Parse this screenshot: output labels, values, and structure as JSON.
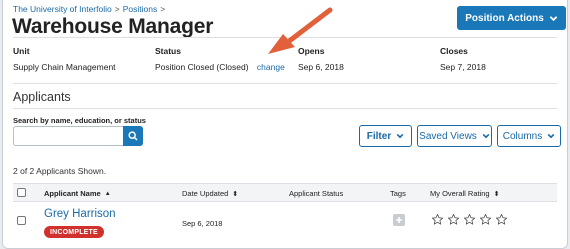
{
  "breadcrumb": {
    "root": "The University of Interfolio",
    "sep": ">",
    "current": "Positions",
    "trail": ">"
  },
  "header": {
    "title": "Warehouse Manager",
    "actions_label": "Position Actions"
  },
  "meta": {
    "unit_label": "Unit",
    "unit_value": "Supply Chain Management",
    "status_label": "Status",
    "status_value": "Position Closed (Closed)",
    "status_change": "change",
    "opens_label": "Opens",
    "opens_value": "Sep 6, 2018",
    "closes_label": "Closes",
    "closes_value": "Sep 7, 2018"
  },
  "applicants": {
    "heading": "Applicants",
    "search_label": "Search by name, education, or status",
    "search_value": "",
    "filter_label": "Filter",
    "saved_views_label": "Saved Views",
    "columns_label": "Columns",
    "count_text": "2 of 2 Applicants Shown.",
    "columns": {
      "name": "Applicant Name",
      "name_sort": "▲",
      "date": "Date Updated",
      "date_sort": "⬍",
      "status": "Applicant Status",
      "tags": "Tags",
      "rating": "My Overall Rating",
      "rating_sort": "⬍"
    },
    "rows": [
      {
        "name": "Grey Harrison",
        "badge": "INCOMPLETE",
        "date": "Sep 6, 2018",
        "status": "",
        "rating": 0,
        "rating_max": 5
      }
    ]
  },
  "colors": {
    "primary": "#1a77b8",
    "link": "#1a6aa8",
    "badge": "#d0312d",
    "arrow": "#e2603a"
  },
  "icons": {
    "search": "search-icon",
    "chevron": "chevron-down-icon",
    "tag_add": "plus-icon",
    "star": "star-outline-icon"
  }
}
